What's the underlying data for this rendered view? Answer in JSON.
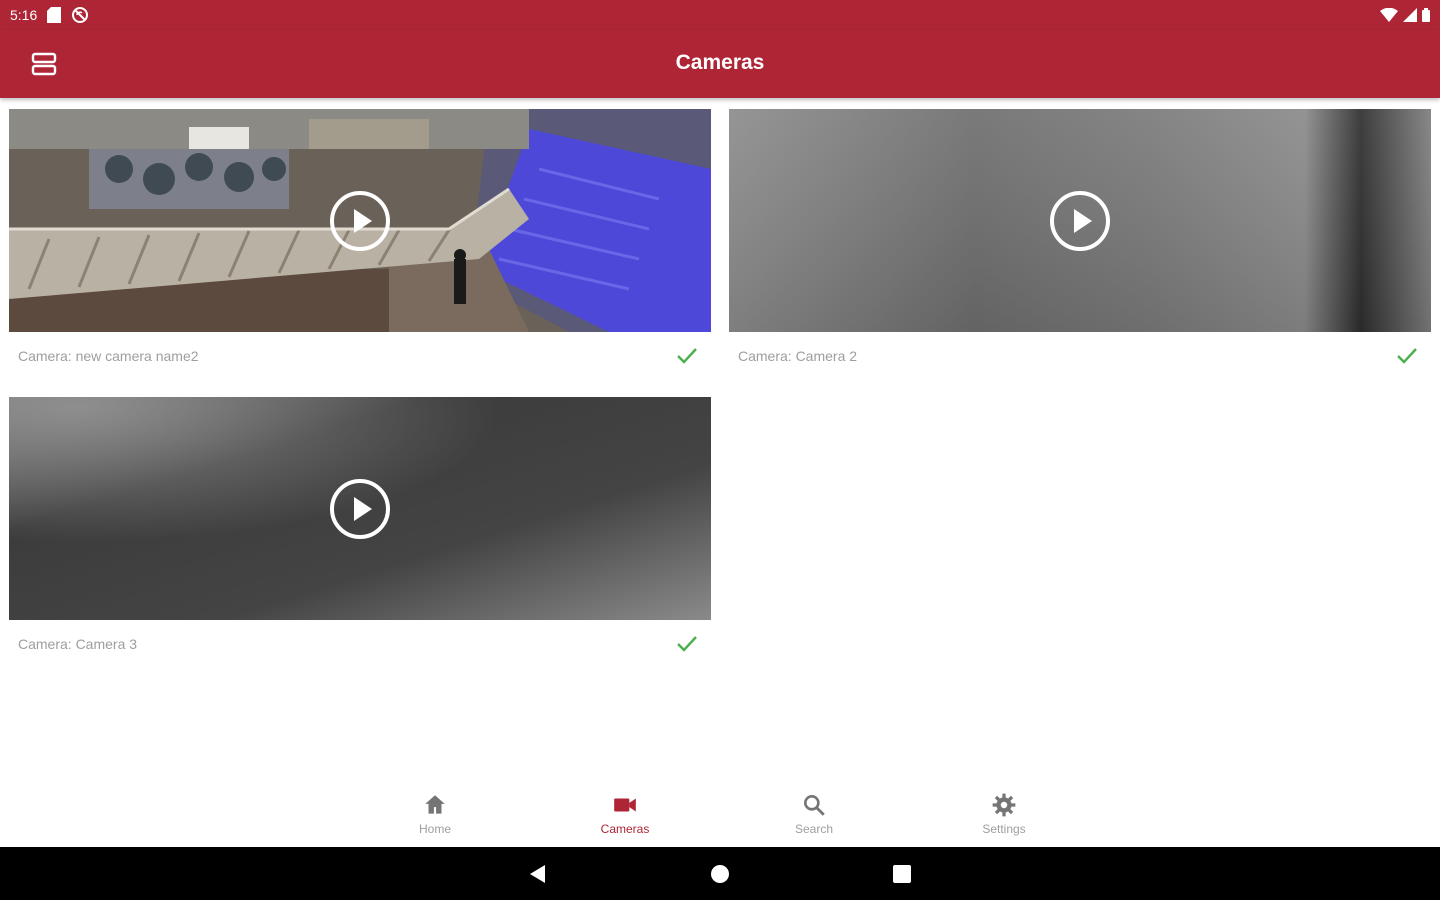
{
  "status_bar": {
    "time": "5:16",
    "left_icons": [
      "sd-card-icon",
      "no-sync-icon"
    ],
    "right_icons": [
      "wifi-icon",
      "signal-icon",
      "battery-icon"
    ]
  },
  "app_bar": {
    "title": "Cameras",
    "menu_icon": "view-agenda-icon"
  },
  "cameras": [
    {
      "label": "Camera: new camera name2",
      "status_icon": "check-icon"
    },
    {
      "label": "Camera: Camera 2",
      "status_icon": "check-icon"
    },
    {
      "label": "Camera: Camera 3",
      "status_icon": "check-icon"
    }
  ],
  "bottom_nav": {
    "items": [
      {
        "label": "Home",
        "icon": "home-icon",
        "active": false
      },
      {
        "label": "Cameras",
        "icon": "videocam-icon",
        "active": true
      },
      {
        "label": "Search",
        "icon": "search-icon",
        "active": false
      },
      {
        "label": "Settings",
        "icon": "gear-icon",
        "active": false
      }
    ]
  },
  "colors": {
    "primary": "#ae2636",
    "check": "#4caf50",
    "caption_text": "#9e9e9e",
    "nav_inactive": "#9e9e9e"
  }
}
